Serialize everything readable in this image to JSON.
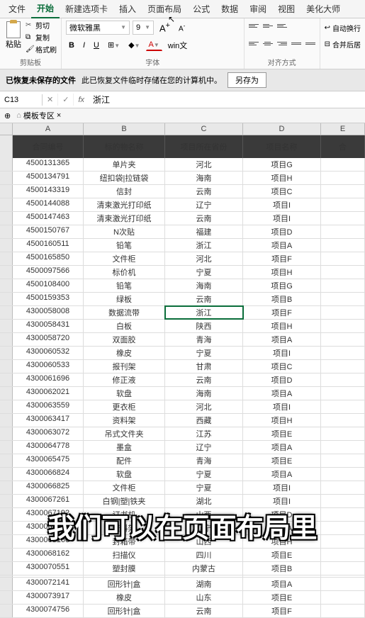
{
  "menu": {
    "items": [
      "文件",
      "开始",
      "新建选项卡",
      "插入",
      "页面布局",
      "公式",
      "数据",
      "审阅",
      "视图",
      "美化大师"
    ],
    "active_index": 4
  },
  "ribbon": {
    "paste": {
      "label": "粘贴",
      "cut": "剪切",
      "copy": "复制",
      "format": "格式刷",
      "group": "剪贴板"
    },
    "font": {
      "name": "微软雅黑",
      "size": "9",
      "group": "字体",
      "bold": "B",
      "italic": "I",
      "underline": "U",
      "sizeUp": "A",
      "sizeDown": "A"
    },
    "win": "win文",
    "align": {
      "group": "对齐方式"
    },
    "wrap": "自动换行",
    "merge": "合并后居"
  },
  "recover": {
    "title": "已恢复未保存的文件",
    "msg": "此已恢复文件临时存储在您的计算机中。",
    "btn": "另存为"
  },
  "namebox": "C13",
  "fx": "fx",
  "formula": "浙江",
  "tabs": {
    "template": "模板专区"
  },
  "cols": [
    "A",
    "B",
    "C",
    "D",
    "E"
  ],
  "headers": [
    "合同编号",
    "标的物名称",
    "项目所在省份",
    "项目名称",
    "合"
  ],
  "selected_row": 13,
  "rows": [
    [
      "4500131365",
      "单片夹",
      "河北",
      "项目G"
    ],
    [
      "4500134791",
      "纽扣袋|拉链袋",
      "海南",
      "项目H"
    ],
    [
      "4500143319",
      "信封",
      "云南",
      "项目C"
    ],
    [
      "4500144088",
      "清束激光打印纸",
      "辽宁",
      "项目I"
    ],
    [
      "4500147463",
      "清束激光打印纸",
      "云南",
      "项目I"
    ],
    [
      "4500150767",
      "N次贴",
      "福建",
      "项目D"
    ],
    [
      "4500160511",
      "铅笔",
      "浙江",
      "项目A"
    ],
    [
      "4500165850",
      "文件柜",
      "河北",
      "项目F"
    ],
    [
      "4500097566",
      "标价机",
      "宁夏",
      "项目H"
    ],
    [
      "4500108400",
      "铅笔",
      "海南",
      "项目G"
    ],
    [
      "4500159353",
      "绿板",
      "云南",
      "项目B"
    ],
    [
      "4300058008",
      "数据流带",
      "浙江",
      "项目F"
    ],
    [
      "4300058431",
      "白板",
      "陕西",
      "项目H"
    ],
    [
      "4300058720",
      "双面胶",
      "青海",
      "项目A"
    ],
    [
      "4300060532",
      "橡皮",
      "宁夏",
      "项目I"
    ],
    [
      "4300060533",
      "报刊架",
      "甘肃",
      "项目C"
    ],
    [
      "4300061696",
      "修正液",
      "云南",
      "项目D"
    ],
    [
      "4300062021",
      "软盘",
      "海南",
      "项目A"
    ],
    [
      "4300063559",
      "更衣柜",
      "河北",
      "项目I"
    ],
    [
      "4300063417",
      "资料架",
      "西藏",
      "项目H"
    ],
    [
      "4300063072",
      "吊式文件夹",
      "江苏",
      "项目E"
    ],
    [
      "4300064778",
      "墨盒",
      "辽宁",
      "项目A"
    ],
    [
      "4300065475",
      "配件",
      "青海",
      "项目E"
    ],
    [
      "4300066824",
      "软盘",
      "宁夏",
      "项目A"
    ],
    [
      "4300066825",
      "文件柜",
      "宁夏",
      "项目I"
    ],
    [
      "4300067261",
      "白钢|塑|铁夹",
      "湖北",
      "项目I"
    ],
    [
      "4300067192",
      "订书机",
      "山西",
      "项目D"
    ],
    [
      "4300067260",
      "资料架",
      "辽宁",
      "项目A"
    ],
    [
      "4300068160",
      "封箱带",
      "山西",
      "项目H"
    ],
    [
      "4300068162",
      "扫描仪",
      "四川",
      "项目E"
    ],
    [
      "4300070551",
      "塑封膜",
      "内蒙古",
      "项目B"
    ],
    [
      "",
      "",
      "",
      ""
    ],
    [
      "4300072141",
      "回形针|盒",
      "湖南",
      "项目A"
    ],
    [
      "4300073917",
      "橡皮",
      "山东",
      "项目E"
    ],
    [
      "4300074756",
      "回形针|盒",
      "云南",
      "项目F"
    ]
  ],
  "subtitle": "我们可以在页面布局里"
}
